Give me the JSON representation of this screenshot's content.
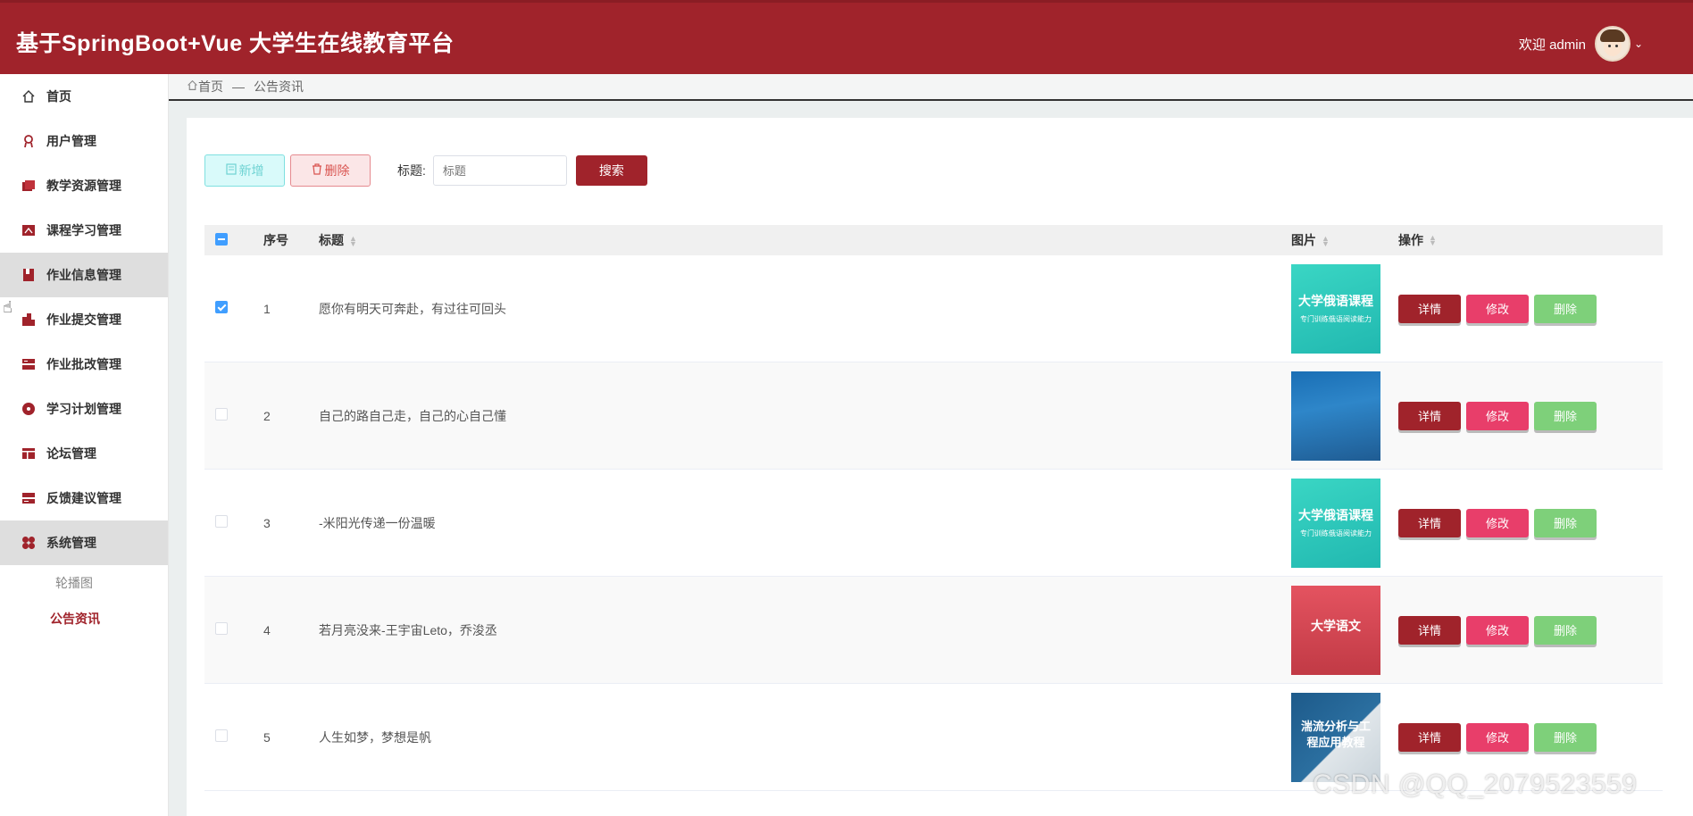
{
  "header": {
    "title": "基于SpringBoot+Vue 大学生在线教育平台",
    "welcome": "欢迎 admin",
    "accent": "#a0232b"
  },
  "sidebar": {
    "items": [
      {
        "label": "首页",
        "icon": "home-icon"
      },
      {
        "label": "用户管理",
        "icon": "user-badge-icon"
      },
      {
        "label": "教学资源管理",
        "icon": "books-icon"
      },
      {
        "label": "课程学习管理",
        "icon": "course-icon"
      },
      {
        "label": "作业信息管理",
        "icon": "homework-icon"
      },
      {
        "label": "作业提交管理",
        "icon": "submit-icon"
      },
      {
        "label": "作业批改管理",
        "icon": "grading-icon"
      },
      {
        "label": "学习计划管理",
        "icon": "plan-icon"
      },
      {
        "label": "论坛管理",
        "icon": "forum-icon"
      },
      {
        "label": "反馈建议管理",
        "icon": "feedback-icon"
      },
      {
        "label": "系统管理",
        "icon": "system-icon"
      }
    ],
    "subitems": [
      {
        "label": "轮播图"
      },
      {
        "label": "公告资讯"
      }
    ]
  },
  "breadcrumb": {
    "home": "首页",
    "separator": "—",
    "current": "公告资讯"
  },
  "toolbar": {
    "new_label": "新增",
    "delete_label": "删除",
    "filter_label": "标题:",
    "filter_placeholder": "标题",
    "search_label": "搜索"
  },
  "table": {
    "headers": {
      "index": "序号",
      "title": "标题",
      "image": "图片",
      "ops": "操作"
    },
    "rows": [
      {
        "index": "1",
        "title": "愿你有明天可奔赴，有过往可回头",
        "thumb_text": "大学俄语课程",
        "thumb_sub": "专门训练俄语阅读能力"
      },
      {
        "index": "2",
        "title": "自己的路自己走，自己的心自己懂",
        "thumb_text": "",
        "thumb_sub": ""
      },
      {
        "index": "3",
        "title": "-米阳光传递一份温暖",
        "thumb_text": "大学俄语课程",
        "thumb_sub": "专门训练俄语阅读能力"
      },
      {
        "index": "4",
        "title": "若月亮没来-王宇宙Leto，乔浚丞",
        "thumb_text": "大学语文",
        "thumb_sub": ""
      },
      {
        "index": "5",
        "title": "人生如梦，梦想是帆",
        "thumb_text": "湍流分析与工程应用教程",
        "thumb_sub": ""
      }
    ],
    "op_labels": {
      "detail": "详情",
      "edit": "修改",
      "remove": "删除"
    }
  },
  "watermark": "CSDN @QQ_2079523559"
}
